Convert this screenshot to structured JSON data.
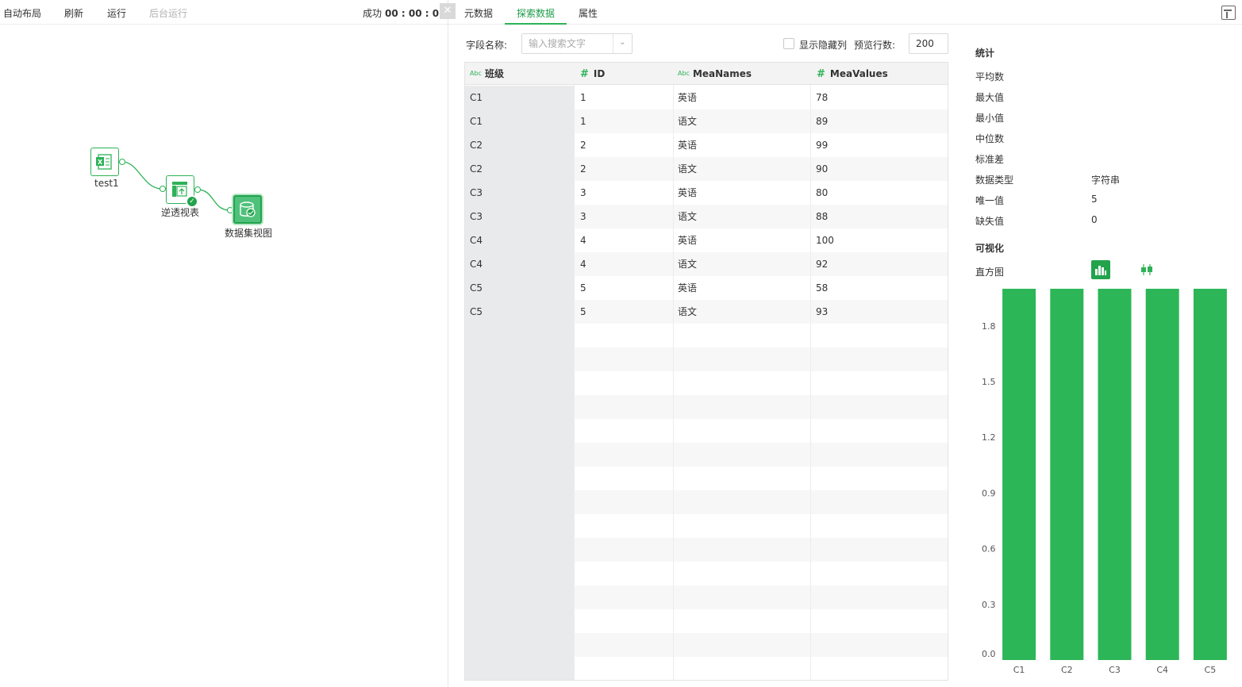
{
  "toolbar": {
    "auto_layout": "自动布局",
    "refresh": "刷新",
    "run": "运行",
    "background_run": "后台运行",
    "status_label": "成功",
    "status_time": "00 : 00 : 01"
  },
  "flow": {
    "nodes": [
      {
        "label": "test1",
        "icon": "excel-icon"
      },
      {
        "label": "逆透视表",
        "icon": "unpivot-table-icon",
        "status": "success-check-icon"
      },
      {
        "label": "数据集视图",
        "icon": "dataset-view-icon"
      }
    ]
  },
  "tabs": [
    {
      "label": "元数据"
    },
    {
      "label": "探索数据",
      "active": true
    },
    {
      "label": "属性"
    }
  ],
  "filter": {
    "field_label": "字段名称:",
    "search_placeholder": "输入搜索文字",
    "show_hidden_label": "显示隐藏列",
    "preview_rows_label": "预览行数:",
    "preview_rows_value": "200"
  },
  "table": {
    "columns": [
      {
        "name": "班级",
        "type": "Abc"
      },
      {
        "name": "ID",
        "type": "#"
      },
      {
        "name": "MeaNames",
        "type": "Abc"
      },
      {
        "name": "MeaValues",
        "type": "#"
      }
    ],
    "rows": [
      [
        "C1",
        "1",
        "英语",
        "78"
      ],
      [
        "C1",
        "1",
        "语文",
        "89"
      ],
      [
        "C2",
        "2",
        "英语",
        "99"
      ],
      [
        "C2",
        "2",
        "语文",
        "90"
      ],
      [
        "C3",
        "3",
        "英语",
        "80"
      ],
      [
        "C3",
        "3",
        "语文",
        "88"
      ],
      [
        "C4",
        "4",
        "英语",
        "100"
      ],
      [
        "C4",
        "4",
        "语文",
        "92"
      ],
      [
        "C5",
        "5",
        "英语",
        "58"
      ],
      [
        "C5",
        "5",
        "语文",
        "93"
      ]
    ]
  },
  "stats": {
    "title": "统计",
    "items": [
      {
        "k": "平均数",
        "v": ""
      },
      {
        "k": "最大值",
        "v": ""
      },
      {
        "k": "最小值",
        "v": ""
      },
      {
        "k": "中位数",
        "v": ""
      },
      {
        "k": "标准差",
        "v": ""
      },
      {
        "k": "数据类型",
        "v": "字符串"
      },
      {
        "k": "唯一值",
        "v": "5"
      },
      {
        "k": "缺失值",
        "v": "0"
      }
    ],
    "viz_title": "可视化",
    "histogram_label": "直方图",
    "viz_buttons": [
      {
        "icon": "bar-chart-icon",
        "active": true
      },
      {
        "icon": "boxplot-icon",
        "active": false
      }
    ]
  },
  "chart_data": {
    "type": "bar",
    "categories": [
      "C1",
      "C2",
      "C3",
      "C4",
      "C5"
    ],
    "values": [
      2,
      2,
      2,
      2,
      2
    ],
    "yticks": [
      "0.0",
      "0.3",
      "0.6",
      "0.9",
      "1.2",
      "1.5",
      "1.8"
    ],
    "ylim": [
      0,
      2
    ],
    "color": "#2cb657"
  },
  "colors": {
    "accent": "#2eb257",
    "bar": "#2cb657"
  }
}
